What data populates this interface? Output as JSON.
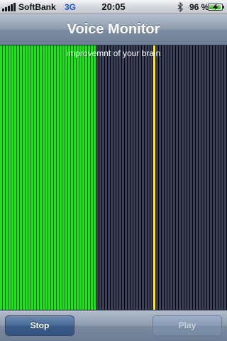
{
  "status_bar": {
    "carrier": "SoftBank",
    "network": "3G",
    "time": "20:05",
    "battery_percent": "96 %",
    "battery_level": 0.96,
    "signal_strength": 5,
    "icons": [
      "signal-bars-icon",
      "bluetooth-icon",
      "battery-icon",
      "charging-bolt-icon"
    ]
  },
  "nav": {
    "title": "Voice Monitor"
  },
  "meter": {
    "caption": "improvemnt of your brain",
    "total_bars": 80,
    "active_bars": 34,
    "peak_bar": 54,
    "colors": {
      "active": "#19e619",
      "inactive": "#3a3f52",
      "peak": "#ffee1a",
      "gap": "#000000"
    }
  },
  "toolbar": {
    "stop_label": "Stop",
    "play_label": "Play",
    "stop_enabled": true,
    "play_enabled": false
  }
}
